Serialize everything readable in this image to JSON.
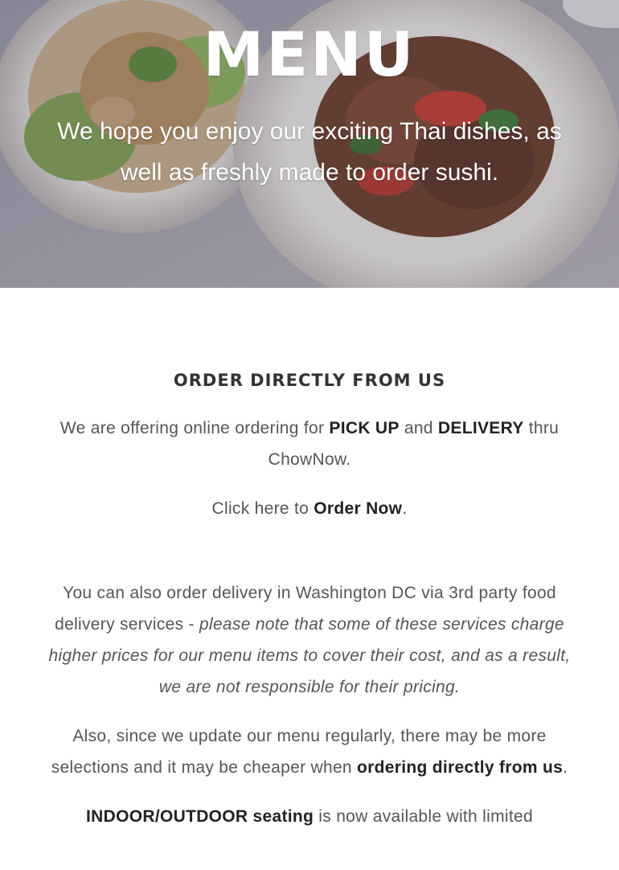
{
  "hero": {
    "title": "MENU",
    "subtitle": "We hope you enjoy our exciting Thai dishes, as well as freshly made to order sushi."
  },
  "section": {
    "heading": "ORDER DIRECTLY FROM US",
    "p1_a": "We are offering online ordering for ",
    "p1_b1": "PICK UP",
    "p1_c": " and ",
    "p1_b2": "DELIVERY",
    "p1_d": " thru ChowNow.",
    "p2_a": "Click here to ",
    "p2_link": "Order Now",
    "p2_b": ".",
    "p3_a": "You can also order delivery in Washington DC via 3rd party food delivery services -  ",
    "p3_em": "please note that some of these services charge higher prices for our menu items to cover their cost, and as a result, we are not responsible for their pricing.",
    "p4_a": "Also, since we update our menu regularly, there may be more selections and it may be cheaper when ",
    "p4_b": "ordering directly from us",
    "p4_c": ".",
    "p5_b": "INDOOR/OUTDOOR seating",
    "p5_a": " is now available with limited"
  }
}
